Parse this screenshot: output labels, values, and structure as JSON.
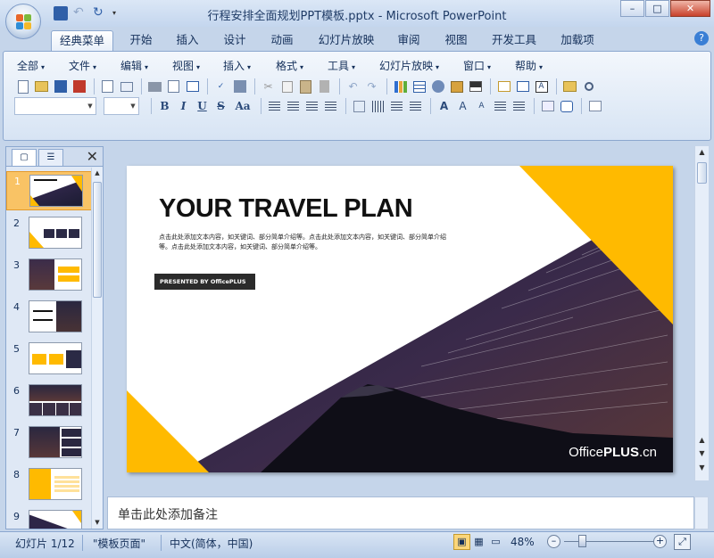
{
  "window": {
    "title": "行程安排全面规划PPT模板.pptx - Microsoft PowerPoint",
    "controls": [
      "–",
      "□",
      "✕"
    ]
  },
  "ribbon_tabs": [
    "经典菜单",
    "开始",
    "插入",
    "设计",
    "动画",
    "幻灯片放映",
    "审阅",
    "视图",
    "开发工具",
    "加载项"
  ],
  "menu_items": [
    "全部",
    "文件",
    "编辑",
    "视图",
    "插入",
    "格式",
    "工具",
    "幻灯片放映",
    "窗口",
    "帮助"
  ],
  "format_buttons": {
    "bold": "B",
    "italic": "I",
    "underline": "U",
    "strike": "S",
    "case": "Aa"
  },
  "text_style_button": "A",
  "slide_panel": {
    "close": "✕",
    "slides": [
      {
        "num": "1"
      },
      {
        "num": "2"
      },
      {
        "num": "3"
      },
      {
        "num": "4"
      },
      {
        "num": "5"
      },
      {
        "num": "6"
      },
      {
        "num": "7"
      },
      {
        "num": "8"
      },
      {
        "num": "9"
      }
    ]
  },
  "slide": {
    "title": "YOUR TRAVEL PLAN",
    "body": "点击此处添加文本内容，如关键词、部分简单介绍等。点击此处添加文本内容，如关键词、部分简单介绍等。点击此处添加文本内容，如关键词、部分简单介绍等。",
    "presented": "PRESENTED BY OfficePLUS",
    "brand_a": "Office",
    "brand_b": "PLUS",
    "brand_c": ".cn"
  },
  "notes_placeholder": "单击此处添加备注",
  "status": {
    "slide": "幻灯片 1/12",
    "template": "\"模板页面\"",
    "language": "中文(简体，中国)",
    "zoom": "48%",
    "zoom_minus": "–",
    "zoom_plus": "+"
  },
  "colors": {
    "accent_yellow": "#ffba00",
    "sky_dark": "#1b1d3a"
  }
}
